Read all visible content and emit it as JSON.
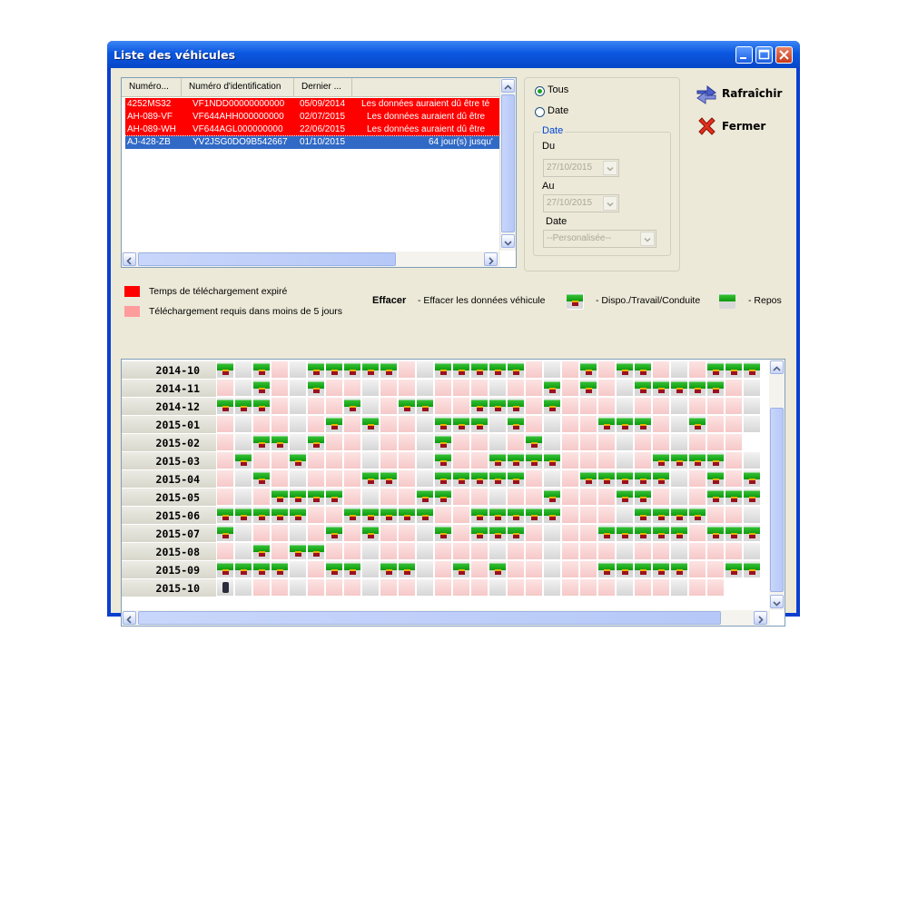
{
  "window": {
    "title": "Liste des véhicules"
  },
  "table": {
    "columns": [
      "Numéro...",
      "Numéro d'identification",
      "Dernier ..."
    ],
    "rows": [
      {
        "plate": "4252MS32",
        "vin": "VF1NDD00000000000",
        "date": "05/09/2014",
        "info": "Les données auraient dû être té",
        "status": "expired"
      },
      {
        "plate": "AH-089-VF",
        "vin": "VF644AHH000000000",
        "date": "02/07/2015",
        "info": "Les données auraient dû être",
        "status": "expired"
      },
      {
        "plate": "AH-089-WH",
        "vin": "VF644AGL000000000",
        "date": "22/06/2015",
        "info": "Les données auraient dû être",
        "status": "expired"
      },
      {
        "plate": "AJ-428-ZB",
        "vin": "YV2JSG0DO9B542667",
        "date": "01/10/2015",
        "info": "64 jour(s) jusqu'",
        "status": "selected"
      }
    ]
  },
  "filter": {
    "all_label": "Tous",
    "date_label": "Date",
    "group_title": "Date",
    "from_label": "Du",
    "from_value": "27/10/2015",
    "to_label": "Au",
    "to_value": "27/10/2015",
    "preset_label": "Date",
    "preset_value": "--Personalisée--",
    "selected": "Tous"
  },
  "actions": {
    "refresh": "Rafraîchir",
    "close": "Fermer"
  },
  "legend": {
    "expired": "Temps de téléchargement expiré",
    "soon": "Téléchargement requis dans moins de 5 jours",
    "erase_title": "Effacer",
    "erase_desc": "- Effacer les données véhicule",
    "work": "- Dispo./Travail/Conduite",
    "rest": "- Repos"
  },
  "colors": {
    "expired": "#ff0000",
    "soon": "#ff9c9c",
    "work": "#20ab20",
    "selected": "#3169c6"
  },
  "calendar": {
    "months": [
      {
        "label": "2014-10",
        "days": "GPGPPGGGGGPPGGGGGPPPGPGGPPPGGG"
      },
      {
        "label": "2014-11",
        "days": "PPGPPGPPPPPPPPPPPPGPGPPGGGGGPP"
      },
      {
        "label": "2014-12",
        "days": "GGGPPPPGPPGGPPGGGPGPPPPPPPPPPPP"
      },
      {
        "label": "2015-01",
        "days": "PPPPPPGPGPPPGGGPGPPPPGGGPPGPPPG"
      },
      {
        "label": "2015-02",
        "days": "PPGGPGPPPPPPGPPPPGPPPPPPPPPPP"
      },
      {
        "label": "2015-03",
        "days": "PGPPGPPPPPPPGPPGGGGPPPPPGGGGPPGG"
      },
      {
        "label": "2015-04",
        "days": "PPGPPPPPGGPPGGGGGPPPGGGGGPPGPGG"
      },
      {
        "label": "2015-05",
        "days": "PPPGGGGPPPPGGPPPPPGPPPGGPPPGGGPP"
      },
      {
        "label": "2015-06",
        "days": "GGGGGPPGGGGGPPGGGGGPPPPGGGGPPPG"
      },
      {
        "label": "2015-07",
        "days": "GPPPPPGPGPPPGPGGGPPPPGGGGGPGGGGG"
      },
      {
        "label": "2015-08",
        "days": "PPGPGGPPPPPPPPPPPPPPPPPPPPPPPPPG"
      },
      {
        "label": "2015-09",
        "days": "GGGGPPGGPGGPPGPGPPPPPGGGGGPPGGG"
      },
      {
        "label": "2015-10",
        "days": "DPPPPPPPPPPPPPPPPPPPPPPPPPPP"
      }
    ]
  }
}
